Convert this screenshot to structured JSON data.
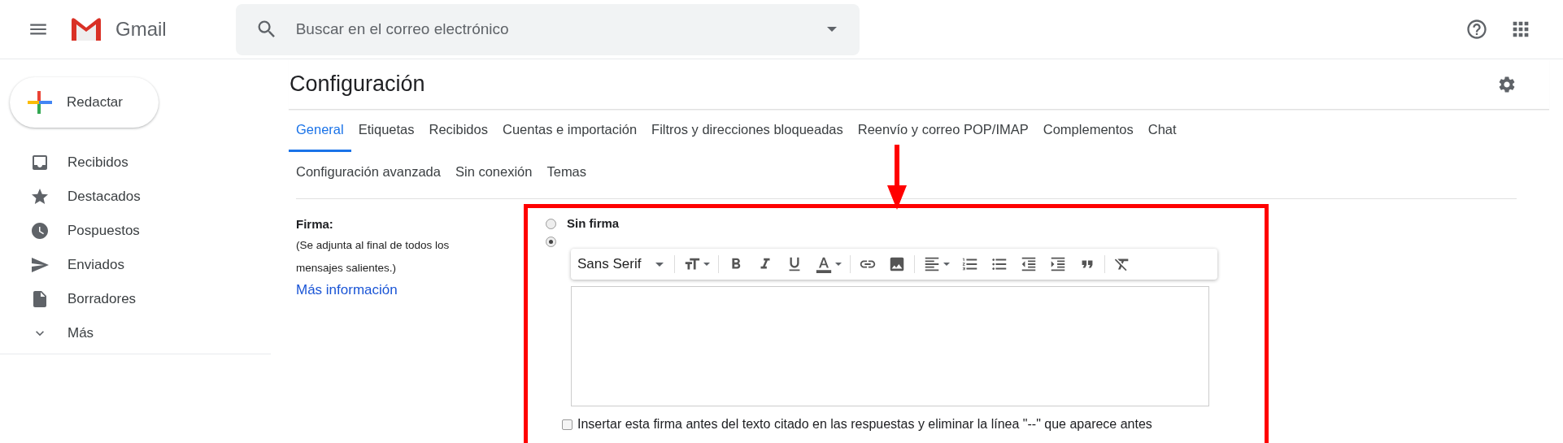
{
  "header": {
    "app_name": "Gmail",
    "search": {
      "placeholder": "Buscar en el correo electrónico"
    }
  },
  "sidebar": {
    "compose": "Redactar",
    "items": [
      {
        "label": "Recibidos",
        "kind": "inbox"
      },
      {
        "label": "Destacados",
        "kind": "star"
      },
      {
        "label": "Pospuestos",
        "kind": "clock"
      },
      {
        "label": "Enviados",
        "kind": "send"
      },
      {
        "label": "Borradores",
        "kind": "draft"
      },
      {
        "label": "Más",
        "kind": "more"
      }
    ]
  },
  "page": {
    "title": "Configuración",
    "tabs": [
      {
        "label": "General",
        "selected": true
      },
      {
        "label": "Etiquetas",
        "selected": false
      },
      {
        "label": "Recibidos",
        "selected": false
      },
      {
        "label": "Cuentas e importación",
        "selected": false
      },
      {
        "label": "Filtros y direcciones bloqueadas",
        "selected": false
      },
      {
        "label": "Reenvío y correo POP/IMAP",
        "selected": false
      },
      {
        "label": "Complementos",
        "selected": false
      },
      {
        "label": "Chat",
        "selected": false
      },
      {
        "label": "Configuración avanzada",
        "selected": false
      },
      {
        "label": "Sin conexión",
        "selected": false
      },
      {
        "label": "Temas",
        "selected": false
      }
    ],
    "signature": {
      "label": "Firma:",
      "description": "(Se adjunta al final de todos los mensajes salientes.)",
      "link": "Más información",
      "options": [
        {
          "label": "Sin firma",
          "selected": false
        },
        {
          "selected": true
        }
      ],
      "font_select": "Sans Serif",
      "insert_before_quote": {
        "label": "Insertar esta firma antes del texto citado en las respuestas y eliminar la línea \"--\" que aparece antes",
        "checked": false
      }
    }
  }
}
